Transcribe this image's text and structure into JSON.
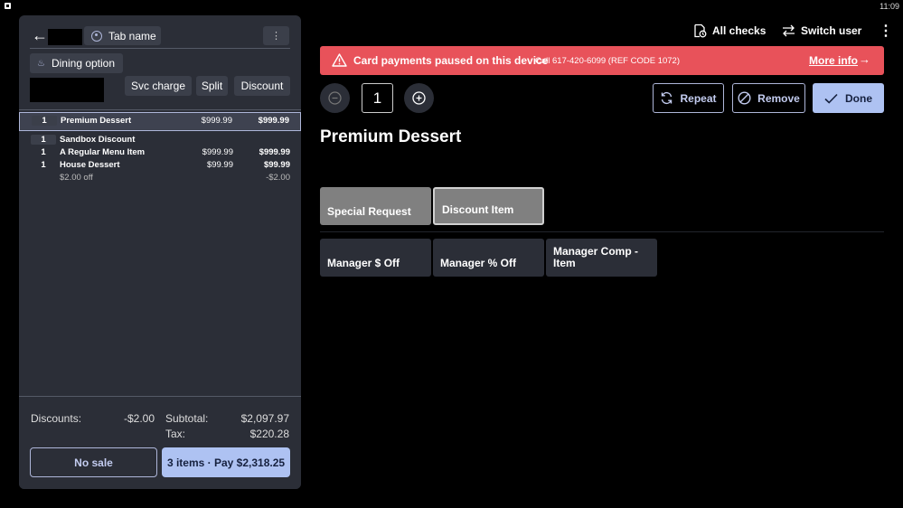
{
  "status_bar": {
    "time": "11:09"
  },
  "left_panel": {
    "tab_name": "Tab name",
    "dining_option": "Dining option",
    "actions": {
      "svc_charge": "Svc charge",
      "split": "Split",
      "discount": "Discount"
    },
    "items": [
      {
        "qty": "1",
        "name": "Premium Dessert",
        "unit": "$999.99",
        "total": "$999.99",
        "selected": true
      },
      {
        "qty": "1",
        "name": "Sandbox Discount",
        "unit": "",
        "total": ""
      },
      {
        "qty": "1",
        "name": "A Regular Menu Item",
        "unit": "$999.99",
        "total": "$999.99"
      },
      {
        "qty": "1",
        "name": "House Dessert",
        "unit": "$99.99",
        "total": "$99.99"
      },
      {
        "qty": "",
        "name": "$2.00 off",
        "unit": "",
        "total": "-$2.00",
        "sub": true
      }
    ],
    "totals": {
      "discounts_label": "Discounts:",
      "discounts_value": "-$2.00",
      "subtotal_label": "Subtotal:",
      "subtotal_value": "$2,097.97",
      "tax_label": "Tax:",
      "tax_value": "$220.28"
    },
    "no_sale": "No sale",
    "pay": "3 items · Pay $2,318.25"
  },
  "header": {
    "all_checks": "All checks",
    "switch_user": "Switch user"
  },
  "alert": {
    "title": "Card payments paused on this device",
    "subtitle": "Call 617-420-6099 (REF CODE 1072)",
    "more_info": "More info"
  },
  "item_editor": {
    "quantity": "1",
    "repeat": "Repeat",
    "remove": "Remove",
    "done": "Done",
    "title": "Premium Dessert",
    "modifiers_row1": [
      "Special Request",
      "Discount Item"
    ],
    "modifiers_row2": [
      "Manager $ Off",
      "Manager % Off",
      "Manager Comp - Item"
    ]
  },
  "colors": {
    "accent": "#aec2f2",
    "alert": "#e8525a",
    "panel": "#2b2e37"
  }
}
